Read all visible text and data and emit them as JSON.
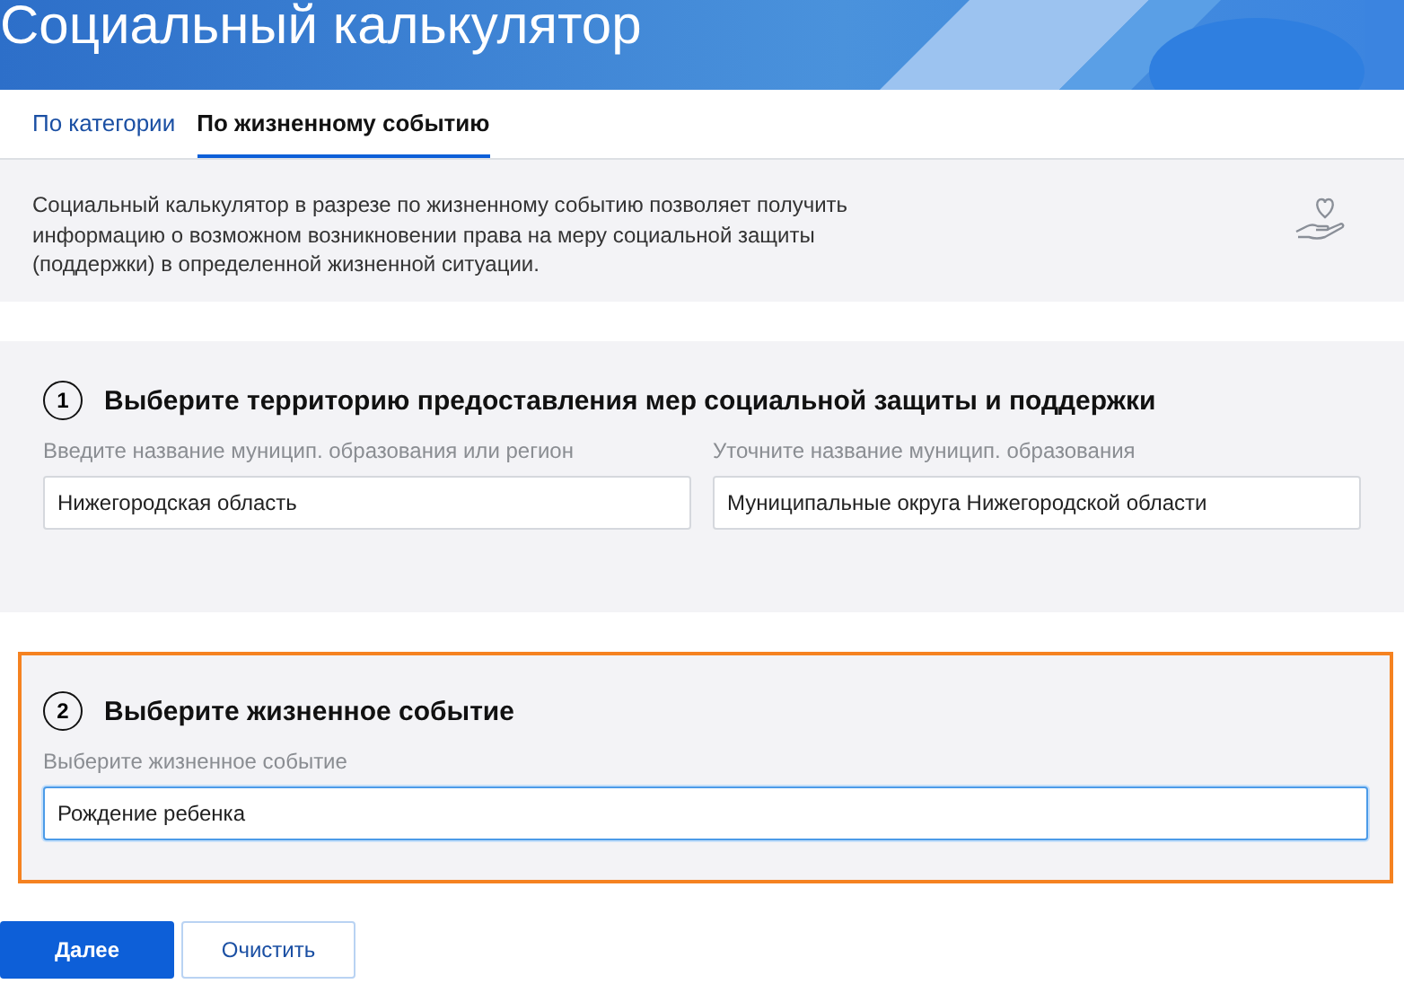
{
  "header": {
    "title": "Социальный калькулятор"
  },
  "tabs": [
    {
      "label": "По категории",
      "selected": false
    },
    {
      "label": "По жизненному событию",
      "selected": true
    }
  ],
  "info": {
    "text": "Социальный калькулятор в разрезе по жизненному событию позволяет получить информацию о возможном возникновении права на меру социальной защиты (поддержки) в определенной жизненной ситуации."
  },
  "sections": [
    {
      "number": "1",
      "title": "Выберите территорию предоставления мер социальной защиты и поддержки",
      "highlighted": false,
      "fields": [
        {
          "label": "Введите название муницип. образования или регион",
          "value": "Нижегородская область",
          "focused": false
        },
        {
          "label": "Уточните название муницип. образования",
          "value": "Муниципальные округа Нижегородской области",
          "focused": false
        }
      ]
    },
    {
      "number": "2",
      "title": "Выберите жизненное событие",
      "highlighted": true,
      "fields": [
        {
          "label": "Выберите жизненное событие",
          "value": "Рождение ребенка",
          "focused": true
        }
      ]
    }
  ],
  "buttons": [
    {
      "label": "Далее",
      "kind": "primary"
    },
    {
      "label": "Очистить",
      "kind": "secondary"
    }
  ]
}
